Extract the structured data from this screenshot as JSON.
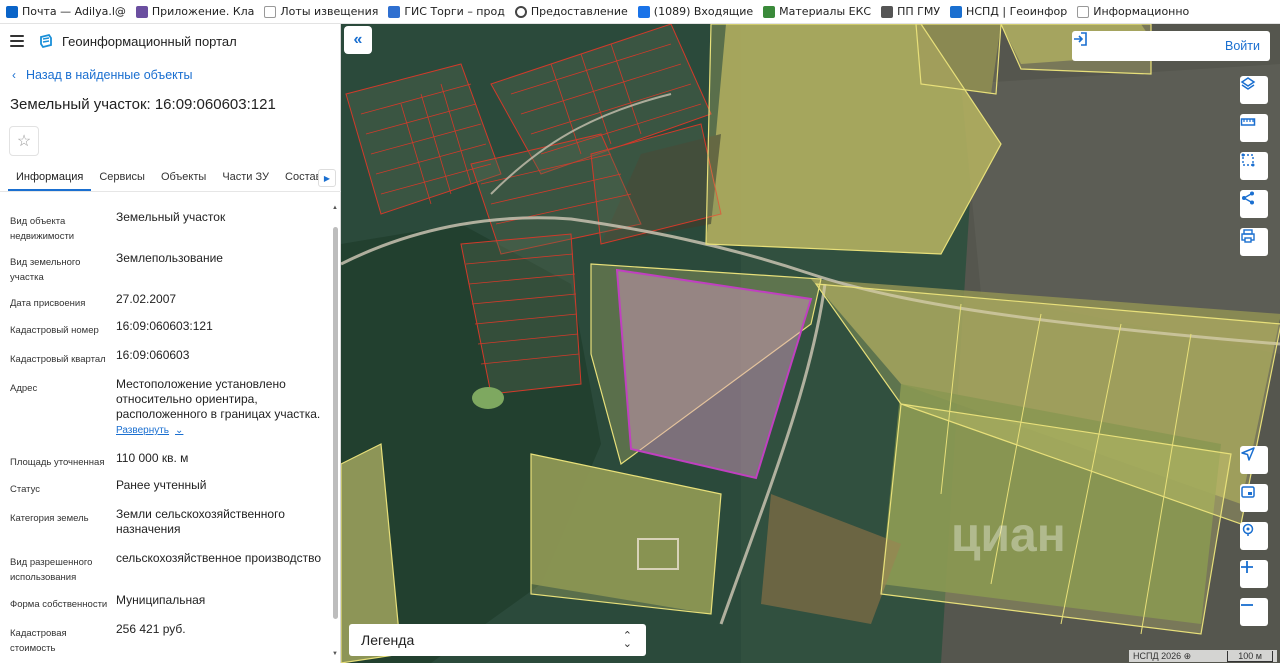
{
  "bookmarks": [
    {
      "label": "Почта — Adilya.l@",
      "color": "#0a64c8"
    },
    {
      "label": "Приложение. Кла",
      "color": "#6b4fa0"
    },
    {
      "label": "Лоты извещения",
      "color": "#c9c9c9"
    },
    {
      "label": "ГИС Торги – прод",
      "color": "#2f6fd0"
    },
    {
      "label": "Предоставление",
      "color": "#444444"
    },
    {
      "label": "(1089) Входящие",
      "color": "#1a73e8"
    },
    {
      "label": "Материалы ЕКС",
      "color": "#3a8a3a"
    },
    {
      "label": "ПП ГМУ",
      "color": "#555555"
    },
    {
      "label": "НСПД | Геоинфор",
      "color": "#1a6fd0"
    },
    {
      "label": "Информационно",
      "color": "#c9c9c9"
    }
  ],
  "header": {
    "title": "Геоинформационный портал"
  },
  "back_link": "Назад в найденные объекты",
  "object_title": "Земельный участок: 16:09:060603:121",
  "tabs": [
    {
      "label": "Информация",
      "active": true
    },
    {
      "label": "Сервисы",
      "active": false
    },
    {
      "label": "Объекты",
      "active": false
    },
    {
      "label": "Части ЗУ",
      "active": false
    },
    {
      "label": "Состав",
      "active": false
    }
  ],
  "properties": [
    {
      "label": "Вид объекта недвижимости",
      "value": "Земельный участок"
    },
    {
      "label": "Вид земельного участка",
      "value": "Землепользование"
    },
    {
      "label": "Дата присвоения",
      "value": "27.02.2007"
    },
    {
      "label": "Кадастровый номер",
      "value": "16:09:060603:121"
    },
    {
      "label": "Кадастровый квартал",
      "value": "16:09:060603"
    },
    {
      "label": "Адрес",
      "value": "Местоположение установлено относительно ориентира, расположенного в границах участка.",
      "link": "Развернуть"
    },
    {
      "label": "Площадь уточненная",
      "value": "110 000 кв. м"
    },
    {
      "label": "Статус",
      "value": "Ранее учтенный"
    },
    {
      "label": "Категория земель",
      "value": "Земли сельскохозяйственного назначения"
    },
    {
      "label": "Вид разрешенного использования",
      "value": "сельскохозяйственное производство"
    },
    {
      "label": "Форма собственности",
      "value": "Муниципальная"
    },
    {
      "label": "Кадастровая стоимость",
      "value": "256 421 руб."
    }
  ],
  "map": {
    "login_label": "Войти",
    "legend_label": "Легенда",
    "attribution": "НСПД 2026 ⊕",
    "scale": "100 м",
    "watermark": "циан",
    "accent": "#1a6fd0",
    "parcel_color": "#c040c0",
    "field_color": "#e8e07a"
  }
}
